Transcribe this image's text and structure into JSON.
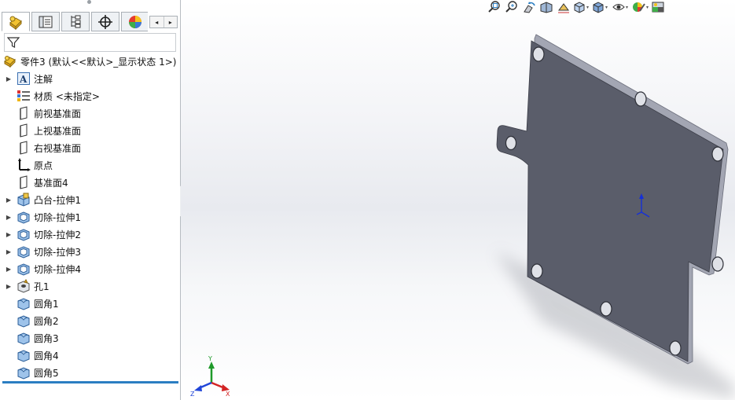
{
  "feature_tree": {
    "root": {
      "label": "零件3  (默认<<默认>_显示状态 1>)",
      "icon": "part-icon"
    },
    "items": [
      {
        "label": "注解",
        "icon": "annotation-icon",
        "expandable": true
      },
      {
        "label": "材质 <未指定>",
        "icon": "material-icon",
        "expandable": false
      },
      {
        "label": "前视基准面",
        "icon": "plane-icon",
        "expandable": false
      },
      {
        "label": "上视基准面",
        "icon": "plane-icon",
        "expandable": false
      },
      {
        "label": "右视基准面",
        "icon": "plane-icon",
        "expandable": false
      },
      {
        "label": "原点",
        "icon": "origin-icon",
        "expandable": false
      },
      {
        "label": "基准面4",
        "icon": "plane-icon",
        "expandable": false
      },
      {
        "label": "凸台-拉伸1",
        "icon": "boss-extrude-icon",
        "expandable": true
      },
      {
        "label": "切除-拉伸1",
        "icon": "cut-extrude-icon",
        "expandable": true
      },
      {
        "label": "切除-拉伸2",
        "icon": "cut-extrude-icon",
        "expandable": true
      },
      {
        "label": "切除-拉伸3",
        "icon": "cut-extrude-icon",
        "expandable": true
      },
      {
        "label": "切除-拉伸4",
        "icon": "cut-extrude-icon",
        "expandable": true
      },
      {
        "label": "孔1",
        "icon": "hole-icon",
        "expandable": true
      },
      {
        "label": "圆角1",
        "icon": "fillet-icon",
        "expandable": false
      },
      {
        "label": "圆角2",
        "icon": "fillet-icon",
        "expandable": false
      },
      {
        "label": "圆角3",
        "icon": "fillet-icon",
        "expandable": false
      },
      {
        "label": "圆角4",
        "icon": "fillet-icon",
        "expandable": false
      },
      {
        "label": "圆角5",
        "icon": "fillet-icon",
        "expandable": false
      }
    ]
  },
  "tabs": [
    {
      "name": "feature-manager-tab",
      "icon": "feature-manager-icon",
      "active": true
    },
    {
      "name": "property-manager-tab",
      "icon": "property-manager-icon",
      "active": false
    },
    {
      "name": "configuration-manager-tab",
      "icon": "configuration-manager-icon",
      "active": false
    },
    {
      "name": "dimxpert-manager-tab",
      "icon": "crosshair-icon",
      "active": false
    },
    {
      "name": "display-manager-tab",
      "icon": "display-manager-icon",
      "active": false
    }
  ],
  "view_toolbar": [
    "zoom-to-fit-icon",
    "zoom-to-area-icon",
    "previous-view-icon",
    "section-view-icon",
    "dynamic-annotation-icon",
    "view-orientation-icon",
    "display-style-icon",
    "hide-show-items-icon",
    "edit-appearance-icon",
    "apply-scene-icon"
  ],
  "triad": {
    "x": "X",
    "y": "Y",
    "z": "Z"
  },
  "colors": {
    "accent": "#2b7ec2",
    "part_face": "#5a5d6a",
    "part_edge": "#a3a6b3"
  }
}
